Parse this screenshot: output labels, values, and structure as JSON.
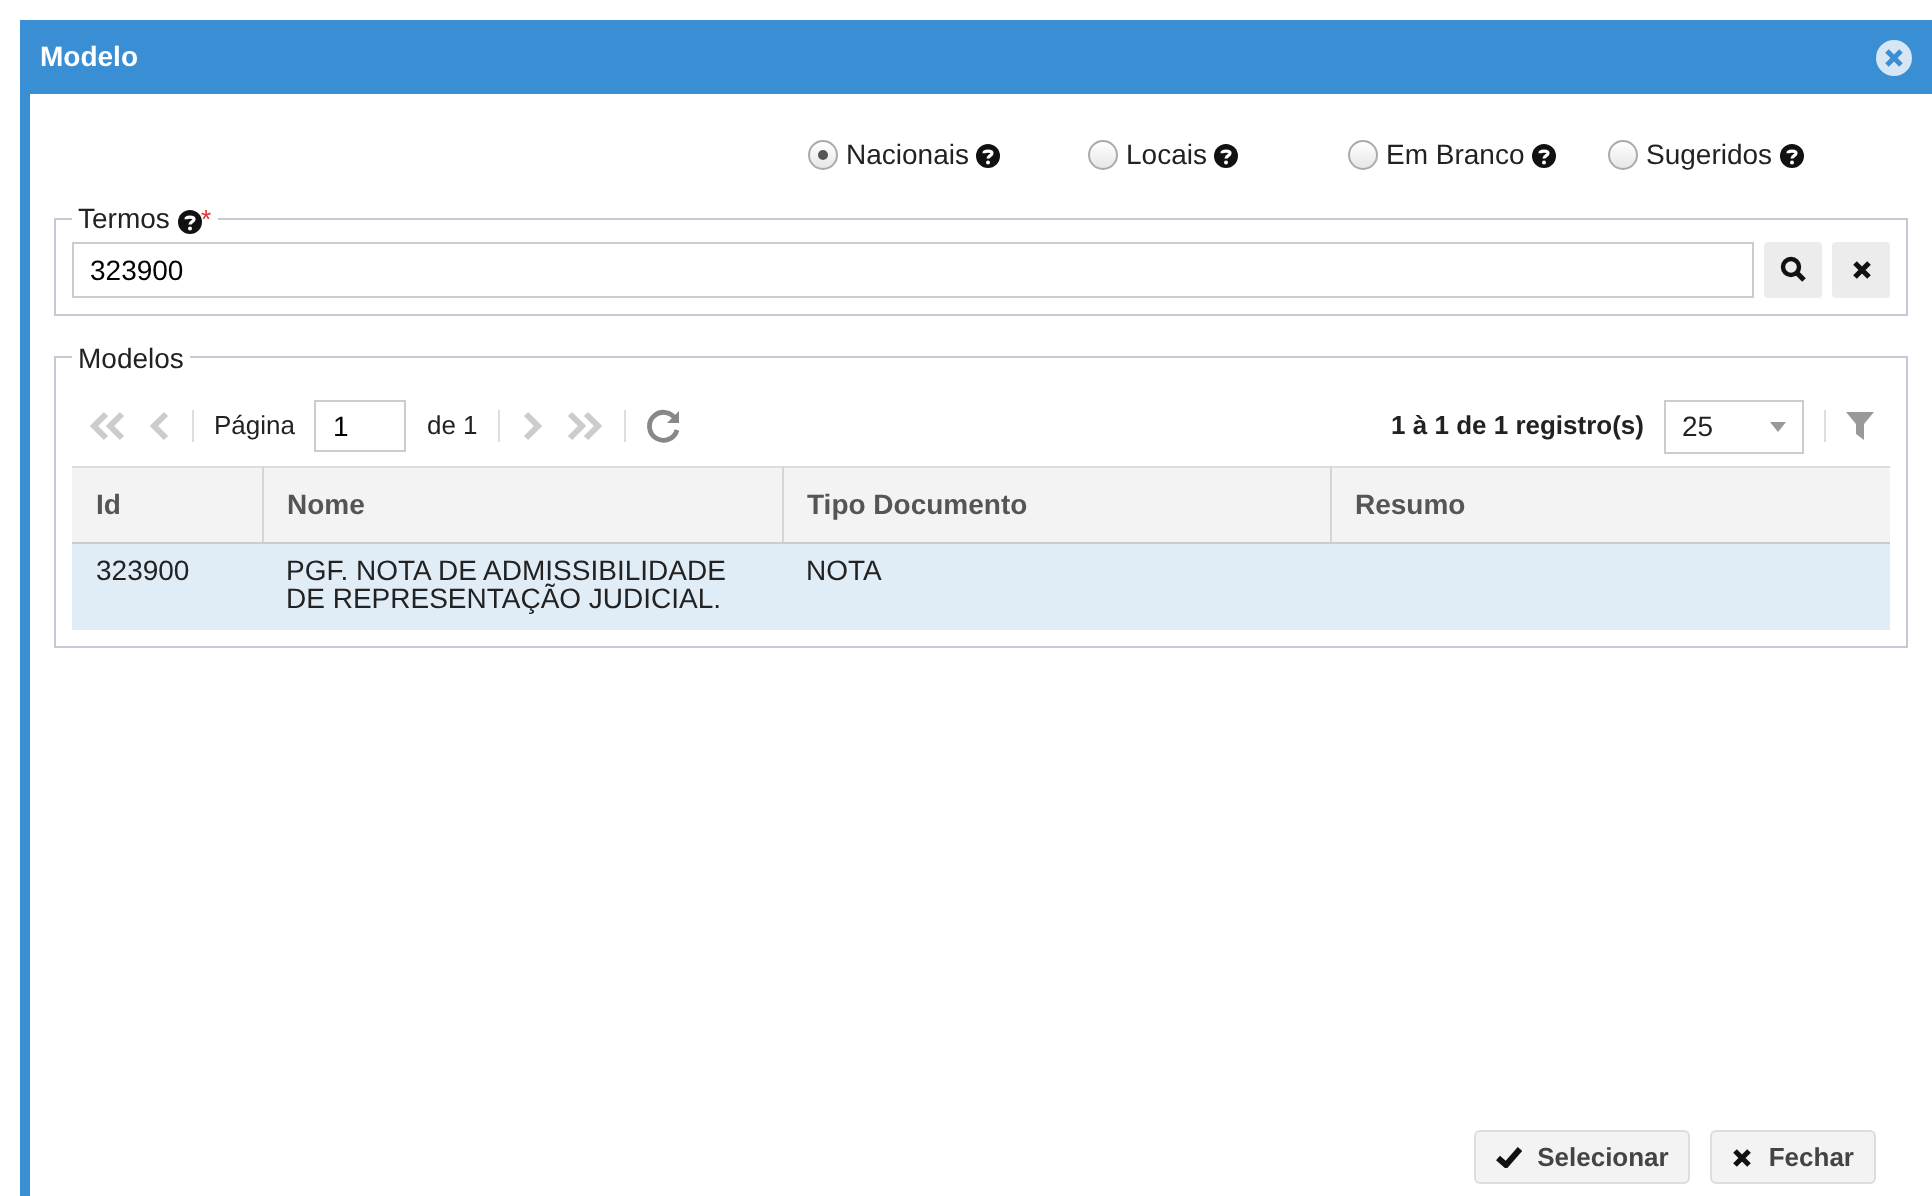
{
  "window": {
    "title": "Modelo"
  },
  "scope_options": [
    {
      "label": "Nacionais",
      "selected": true
    },
    {
      "label": "Locais",
      "selected": false
    },
    {
      "label": "Em Branco",
      "selected": false
    },
    {
      "label": "Sugeridos",
      "selected": false
    }
  ],
  "termos": {
    "legend": "Termos",
    "required_mark": "*",
    "value": "323900"
  },
  "modelos": {
    "legend": "Modelos",
    "page_label": "Página",
    "page": "1",
    "page_total": "de 1",
    "summary": "1 à 1 de 1 registro(s)",
    "page_size": "25",
    "table": {
      "columns": [
        "Id",
        "Nome",
        "Tipo Documento",
        "Resumo"
      ],
      "rows": [
        {
          "selected": true,
          "cells": [
            "323900",
            "PGF. NOTA DE ADMISSIBILIDADE DE REPRESENTAÇÃO JUDICIAL.",
            "NOTA",
            ""
          ]
        }
      ]
    }
  },
  "buttons": [
    {
      "kind": "select",
      "label": "Selecionar"
    },
    {
      "kind": "close",
      "label": "Fechar"
    }
  ]
}
